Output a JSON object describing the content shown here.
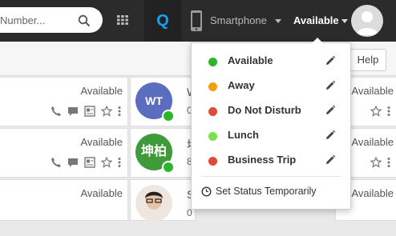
{
  "header": {
    "search_placeholder": "Number...",
    "q_label": "Q",
    "device_label": "Smartphone",
    "status_label": "Available"
  },
  "toolbar": {
    "help_label": "Help"
  },
  "cards_left": [
    {
      "status": "Available"
    },
    {
      "status": "Available"
    },
    {
      "status": "Available"
    }
  ],
  "cards_middle": [
    {
      "initials": "WT",
      "avatar_color": "#5b6dbf",
      "name_fragment": "W",
      "sub_fragment": "0"
    },
    {
      "initials": "坤柏",
      "avatar_color": "#3f9b3a",
      "name_fragment": "坤",
      "sub_fragment": "8"
    },
    {
      "initials": "",
      "avatar_color": "#e8e0d8",
      "name_fragment": "S",
      "sub_fragment": "0"
    }
  ],
  "cards_right": [
    {
      "status": "Available"
    },
    {
      "status": "Available"
    },
    {
      "status": "Available"
    }
  ],
  "status_menu": {
    "items": [
      {
        "label": "Available",
        "color": "#2db52d"
      },
      {
        "label": "Away",
        "color": "#f39c12"
      },
      {
        "label": "Do Not Disturb",
        "color": "#dd4b39"
      },
      {
        "label": "Lunch",
        "color": "#7ddf4a"
      },
      {
        "label": "Business Trip",
        "color": "#dd4b39"
      }
    ],
    "temp_label": "Set Status Temporarily"
  },
  "colors": {
    "topbar": "#2b2b2b",
    "accent": "#1a9ff0",
    "presence": "#2bb52b"
  }
}
